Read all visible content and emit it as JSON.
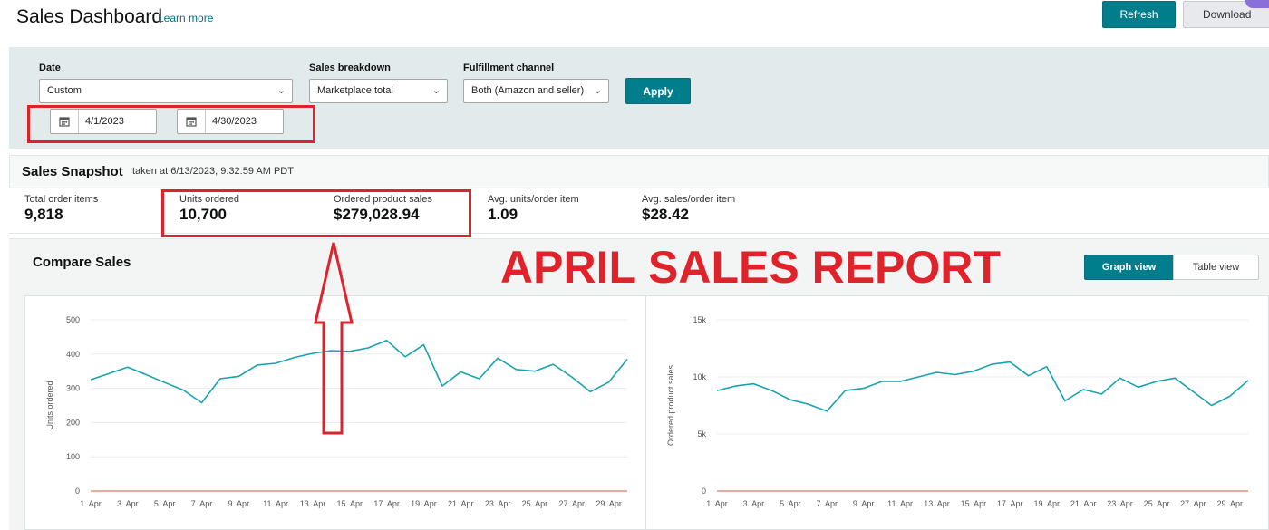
{
  "header": {
    "title": "Sales Dashboard",
    "learn_more": "Learn more",
    "refresh_label": "Refresh",
    "download_label": "Download"
  },
  "filters": {
    "date_label": "Date",
    "date_value": "Custom",
    "breakdown_label": "Sales breakdown",
    "breakdown_value": "Marketplace total",
    "channel_label": "Fulfillment channel",
    "channel_value": "Both (Amazon and seller)",
    "apply_label": "Apply",
    "start_date": "4/1/2023",
    "end_date": "4/30/2023"
  },
  "snapshot": {
    "title": "Sales Snapshot",
    "taken_at": "taken at 6/13/2023, 9:32:59 AM PDT",
    "metrics": [
      {
        "label": "Total order items",
        "value": "9,818"
      },
      {
        "label": "Units ordered",
        "value": "10,700"
      },
      {
        "label": "Ordered product sales",
        "value": "$279,028.94"
      },
      {
        "label": "Avg. units/order item",
        "value": "1.09"
      },
      {
        "label": "Avg. sales/order item",
        "value": "$28.42"
      }
    ]
  },
  "compare": {
    "title": "Compare Sales",
    "graph_view_label": "Graph view",
    "table_view_label": "Table view"
  },
  "overlay": {
    "report_text": "APRIL SALES REPORT"
  },
  "colors": {
    "accent": "#017e8b",
    "series_line": "#1aa3ad",
    "baseline": "#e07a5f",
    "annotation_red": "#e0232b"
  },
  "chart_data": [
    {
      "type": "line",
      "ylabel": "Units ordered",
      "ylim": [
        0,
        500
      ],
      "yticks": [
        "0",
        "100",
        "200",
        "300",
        "400",
        "500"
      ],
      "ytick_values": [
        0,
        100,
        200,
        300,
        400,
        500
      ],
      "x_tick_labels": [
        "1. Apr",
        "3. Apr",
        "5. Apr",
        "7. Apr",
        "9. Apr",
        "11. Apr",
        "13. Apr",
        "15. Apr",
        "17. Apr",
        "19. Apr",
        "21. Apr",
        "23. Apr",
        "25. Apr",
        "27. Apr",
        "29. Apr"
      ],
      "x": [
        1,
        2,
        3,
        4,
        5,
        6,
        7,
        8,
        9,
        10,
        11,
        12,
        13,
        14,
        15,
        16,
        17,
        18,
        19,
        20,
        21,
        22,
        23,
        24,
        25,
        26,
        27,
        28,
        29,
        30
      ],
      "values": [
        325,
        343,
        362,
        340,
        317,
        295,
        258,
        328,
        335,
        368,
        373,
        390,
        402,
        410,
        408,
        418,
        440,
        392,
        427,
        307,
        348,
        328,
        388,
        355,
        350,
        370,
        333,
        290,
        318,
        385
      ],
      "baseline": 0,
      "grid": true
    },
    {
      "type": "line",
      "ylabel": "Ordered product sales",
      "ylim": [
        0,
        15000
      ],
      "yticks": [
        "0",
        "5k",
        "10k",
        "15k"
      ],
      "ytick_values": [
        0,
        5000,
        10000,
        15000
      ],
      "x_tick_labels": [
        "1. Apr",
        "3. Apr",
        "5. Apr",
        "7. Apr",
        "9. Apr",
        "11. Apr",
        "13. Apr",
        "15. Apr",
        "17. Apr",
        "19. Apr",
        "21. Apr",
        "23. Apr",
        "25. Apr",
        "27. Apr",
        "29. Apr"
      ],
      "x": [
        1,
        2,
        3,
        4,
        5,
        6,
        7,
        8,
        9,
        10,
        11,
        12,
        13,
        14,
        15,
        16,
        17,
        18,
        19,
        20,
        21,
        22,
        23,
        24,
        25,
        26,
        27,
        28,
        29,
        30
      ],
      "values": [
        8800,
        9200,
        9400,
        8800,
        8000,
        7600,
        7000,
        8800,
        9000,
        9600,
        9600,
        10000,
        10400,
        10200,
        10500,
        11100,
        11300,
        10100,
        10900,
        7900,
        8900,
        8500,
        9900,
        9100,
        9600,
        9900,
        8700,
        7500,
        8300,
        9700
      ],
      "baseline": 0,
      "grid": true
    }
  ]
}
